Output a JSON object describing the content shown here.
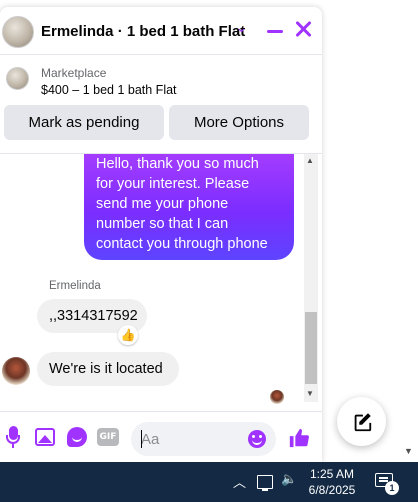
{
  "chat": {
    "header_title": "Ermelinda · 1 bed 1 bath Flat",
    "listing_source": "Marketplace",
    "listing_title": "$400 – 1 bed 1 bath Flat",
    "actions": {
      "mark_pending": "Mark as pending",
      "more_options": "More Options"
    },
    "messages": {
      "outgoing_lines": [
        "Hello, thank you so much",
        "for your interest. Please",
        "send me your phone",
        "number so that I can",
        "contact you through phone"
      ],
      "sender_name": "Ermelinda",
      "incoming_1": ",,3314317592",
      "incoming_1_reaction": "👍",
      "incoming_2": "We're is it located"
    },
    "composer": {
      "placeholder": "Aa",
      "gif_label": "GIF"
    }
  },
  "taskbar": {
    "time": "1:25 AM",
    "date": "6/8/2025",
    "notification_count": "1"
  },
  "colors": {
    "accent": "#a033ff",
    "bubble_gradient_start": "#a43cff",
    "bubble_gradient_end": "#5d44ff",
    "taskbar": "#142a44"
  },
  "icons": [
    "chevron-down-icon",
    "minimize-icon",
    "close-icon",
    "mic-icon",
    "image-icon",
    "sticker-icon",
    "gif-icon",
    "emoji-icon",
    "like-icon",
    "compose-icon",
    "network-icon",
    "volume-icon",
    "notification-icon"
  ]
}
